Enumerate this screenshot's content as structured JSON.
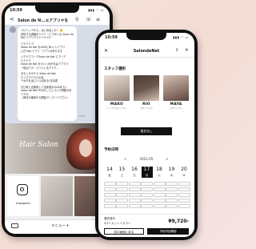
{
  "left_phone": {
    "status_time": "10:59",
    "status_icons": "▮▮▮ ◠ ▭",
    "chat_header": {
      "back": "<",
      "title": "Salon de N...",
      "title_suffix": "エアブリヤを",
      "icons": [
        "search-icon",
        "phone-icon",
        "menu-icon"
      ]
    },
    "message_lines": [
      "ハピャッアから、はじめ出した！ 🤗",
      "送信する連絡がリアド・ビブが入る Salon de",
      "Net アプリアドドリヤド!!",
      "",
      "ドアドドア",
      "Salon de Net をLINEにNI入へ-アプリ",
      "に付 Net アプリ・アプリがあります",
      "",
      "ハアドアコーアSalon de Net にアーア",
      "りドドア",
      "Salon de Net をカシハ対がるはアプアパ",
      "一覧出アカ・さっているアドア...",
      "",
      "おもしろやそう Salon de Net",
      "ビリビアパラスの台",
      "ドボのを出にいつ出ある!日本語",
      "",
      "ぜひ気に合使用して全体表示のLINE 分...",
      "Salon de Net POOのことについで問題があ",
      "ドアの",
      "（毎日の使用から開始マンゴードアさい)"
    ],
    "timestamp": "15:03",
    "banner_script": "Hair Salon",
    "tiles": [
      {
        "label": "Instagram",
        "icon": "instagram-icon"
      },
      {
        "label": ""
      },
      {
        "label": ""
      }
    ],
    "bottom_menu": "メニュー ▾"
  },
  "right_phone": {
    "status_time": "10:59",
    "status_icons": "▮▮▮ ◠ ▭",
    "header": {
      "close": "✕",
      "title": "SalondeNet",
      "icons": [
        "share-icon",
        "close-icon"
      ]
    },
    "staff_section": "スタッフ選択",
    "staff": [
      {
        "name": "MAKO",
        "rank": "トップスタイリスト",
        "photo_color": "#b8a89c"
      },
      {
        "name": "RIO",
        "rank": "スタイリスト",
        "photo_color": "#6a564c"
      },
      {
        "name": "MAYA",
        "rank": "スタイリスト",
        "photo_color": "#9c8478"
      }
    ],
    "staff_button": "指名なし",
    "date_section": "予約日時",
    "month": "2021-05",
    "prev": "<",
    "next": ">",
    "days": [
      {
        "n": "14",
        "w": "金",
        "selected": false
      },
      {
        "n": "15",
        "w": "土",
        "selected": false
      },
      {
        "n": "16",
        "w": "日",
        "selected": false
      },
      {
        "n": "17",
        "w": "月",
        "selected": true
      },
      {
        "n": "18",
        "w": "火",
        "selected": false
      },
      {
        "n": "19",
        "w": "水",
        "selected": false
      },
      {
        "n": "20",
        "w": "木",
        "selected": false
      }
    ],
    "selected_label": "選択済み",
    "service": "5/17 カット＋カラー",
    "price": "¥9,720-",
    "btn_secondary": "前の画面に戻る",
    "btn_primary": "予約内容確認"
  },
  "colors": {
    "background": "#f5e2da",
    "accent": "#111111",
    "line_chat_bg": "#d7dde8"
  }
}
